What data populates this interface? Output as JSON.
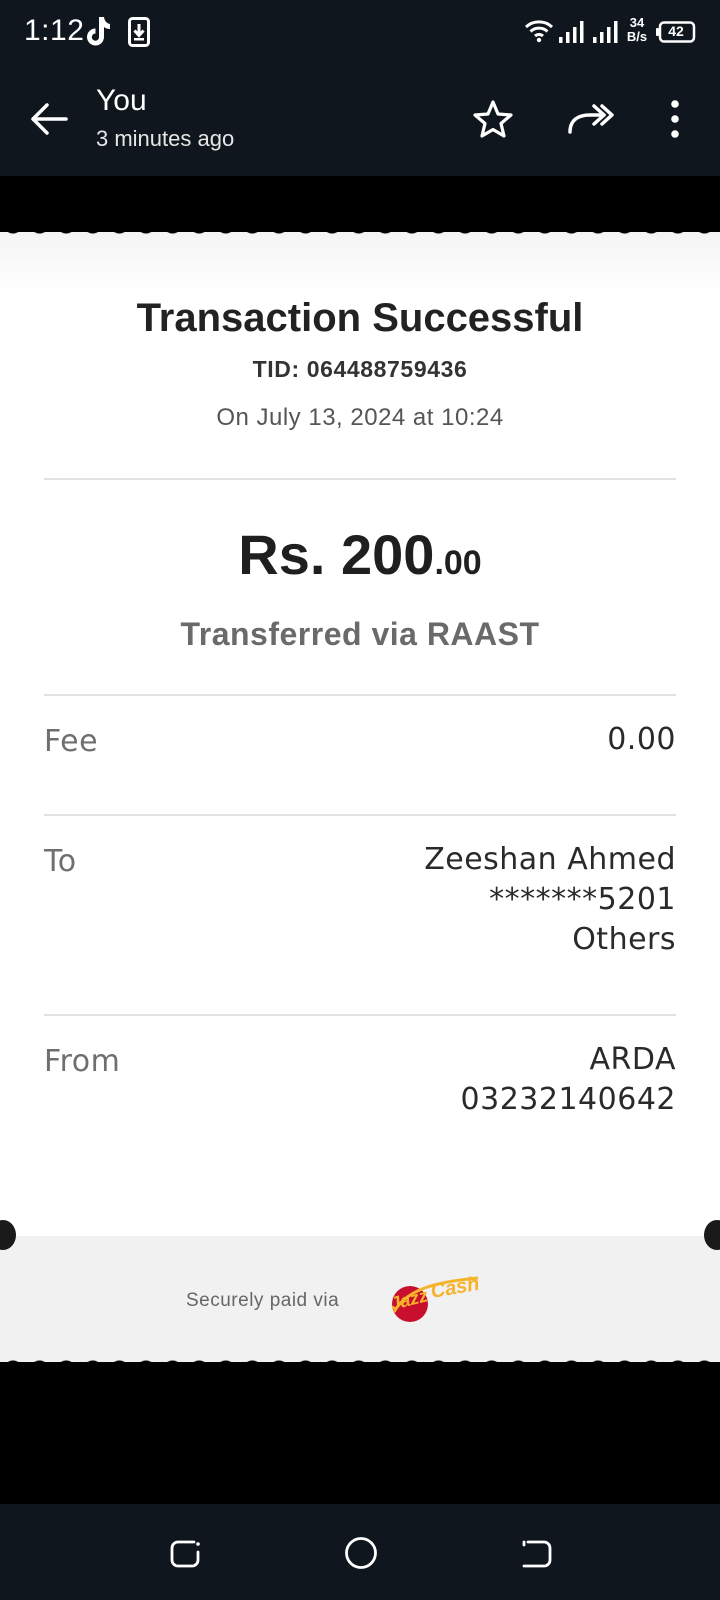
{
  "status_bar": {
    "time": "1:12",
    "speed_top": "34",
    "speed_bottom": "B/s",
    "battery": "42",
    "icons": [
      "tiktok-icon",
      "download-icon",
      "wifi-icon",
      "signal-icon",
      "signal-icon",
      "battery-icon"
    ]
  },
  "app_bar": {
    "sender": "You",
    "sent_time": "3 minutes ago",
    "icons": [
      "back-arrow-icon",
      "star-icon",
      "share-icon",
      "more-vert-icon"
    ]
  },
  "receipt": {
    "title": "Transaction Successful",
    "tid": "TID: 064488759436",
    "date": "On July 13, 2024 at 10:24",
    "amount_main": "Rs. 200",
    "amount_decimal": ".00",
    "method": "Transferred via RAAST",
    "fee_label": "Fee",
    "fee_value": "0.00",
    "to_label": "To",
    "to_name": "Zeeshan Ahmed",
    "to_account": "*******5201",
    "to_bank": "Others",
    "from_label": "From",
    "from_name": "ARDA",
    "from_number": "03232140642",
    "footer_text": "Securely paid via",
    "logo_text": "JazzCash"
  },
  "colors": {
    "bar_background": "#10161d",
    "logo_orange": "#f7b32b",
    "logo_red": "#c8102e"
  },
  "nav_bar": {
    "icons": [
      "recents-icon",
      "home-icon",
      "back-icon"
    ]
  }
}
